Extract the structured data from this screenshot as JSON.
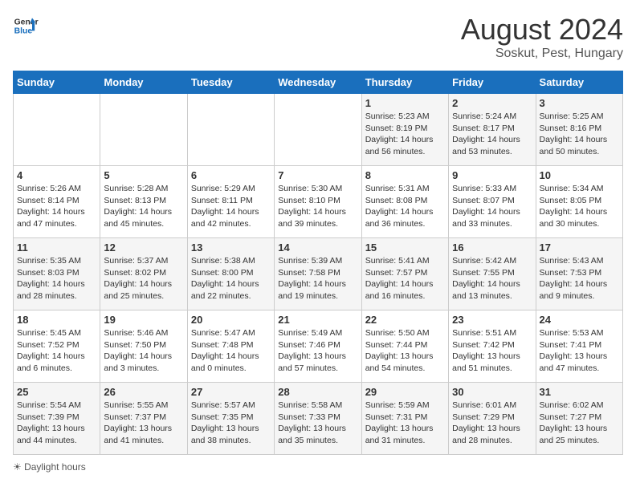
{
  "header": {
    "logo_general": "General",
    "logo_blue": "Blue",
    "month_year": "August 2024",
    "location": "Soskut, Pest, Hungary"
  },
  "weekdays": [
    "Sunday",
    "Monday",
    "Tuesday",
    "Wednesday",
    "Thursday",
    "Friday",
    "Saturday"
  ],
  "legend": {
    "label": "Daylight hours"
  },
  "weeks": [
    [
      {
        "day": "",
        "info": ""
      },
      {
        "day": "",
        "info": ""
      },
      {
        "day": "",
        "info": ""
      },
      {
        "day": "",
        "info": ""
      },
      {
        "day": "1",
        "info": "Sunrise: 5:23 AM\nSunset: 8:19 PM\nDaylight: 14 hours and 56 minutes."
      },
      {
        "day": "2",
        "info": "Sunrise: 5:24 AM\nSunset: 8:17 PM\nDaylight: 14 hours and 53 minutes."
      },
      {
        "day": "3",
        "info": "Sunrise: 5:25 AM\nSunset: 8:16 PM\nDaylight: 14 hours and 50 minutes."
      }
    ],
    [
      {
        "day": "4",
        "info": "Sunrise: 5:26 AM\nSunset: 8:14 PM\nDaylight: 14 hours and 47 minutes."
      },
      {
        "day": "5",
        "info": "Sunrise: 5:28 AM\nSunset: 8:13 PM\nDaylight: 14 hours and 45 minutes."
      },
      {
        "day": "6",
        "info": "Sunrise: 5:29 AM\nSunset: 8:11 PM\nDaylight: 14 hours and 42 minutes."
      },
      {
        "day": "7",
        "info": "Sunrise: 5:30 AM\nSunset: 8:10 PM\nDaylight: 14 hours and 39 minutes."
      },
      {
        "day": "8",
        "info": "Sunrise: 5:31 AM\nSunset: 8:08 PM\nDaylight: 14 hours and 36 minutes."
      },
      {
        "day": "9",
        "info": "Sunrise: 5:33 AM\nSunset: 8:07 PM\nDaylight: 14 hours and 33 minutes."
      },
      {
        "day": "10",
        "info": "Sunrise: 5:34 AM\nSunset: 8:05 PM\nDaylight: 14 hours and 30 minutes."
      }
    ],
    [
      {
        "day": "11",
        "info": "Sunrise: 5:35 AM\nSunset: 8:03 PM\nDaylight: 14 hours and 28 minutes."
      },
      {
        "day": "12",
        "info": "Sunrise: 5:37 AM\nSunset: 8:02 PM\nDaylight: 14 hours and 25 minutes."
      },
      {
        "day": "13",
        "info": "Sunrise: 5:38 AM\nSunset: 8:00 PM\nDaylight: 14 hours and 22 minutes."
      },
      {
        "day": "14",
        "info": "Sunrise: 5:39 AM\nSunset: 7:58 PM\nDaylight: 14 hours and 19 minutes."
      },
      {
        "day": "15",
        "info": "Sunrise: 5:41 AM\nSunset: 7:57 PM\nDaylight: 14 hours and 16 minutes."
      },
      {
        "day": "16",
        "info": "Sunrise: 5:42 AM\nSunset: 7:55 PM\nDaylight: 14 hours and 13 minutes."
      },
      {
        "day": "17",
        "info": "Sunrise: 5:43 AM\nSunset: 7:53 PM\nDaylight: 14 hours and 9 minutes."
      }
    ],
    [
      {
        "day": "18",
        "info": "Sunrise: 5:45 AM\nSunset: 7:52 PM\nDaylight: 14 hours and 6 minutes."
      },
      {
        "day": "19",
        "info": "Sunrise: 5:46 AM\nSunset: 7:50 PM\nDaylight: 14 hours and 3 minutes."
      },
      {
        "day": "20",
        "info": "Sunrise: 5:47 AM\nSunset: 7:48 PM\nDaylight: 14 hours and 0 minutes."
      },
      {
        "day": "21",
        "info": "Sunrise: 5:49 AM\nSunset: 7:46 PM\nDaylight: 13 hours and 57 minutes."
      },
      {
        "day": "22",
        "info": "Sunrise: 5:50 AM\nSunset: 7:44 PM\nDaylight: 13 hours and 54 minutes."
      },
      {
        "day": "23",
        "info": "Sunrise: 5:51 AM\nSunset: 7:42 PM\nDaylight: 13 hours and 51 minutes."
      },
      {
        "day": "24",
        "info": "Sunrise: 5:53 AM\nSunset: 7:41 PM\nDaylight: 13 hours and 47 minutes."
      }
    ],
    [
      {
        "day": "25",
        "info": "Sunrise: 5:54 AM\nSunset: 7:39 PM\nDaylight: 13 hours and 44 minutes."
      },
      {
        "day": "26",
        "info": "Sunrise: 5:55 AM\nSunset: 7:37 PM\nDaylight: 13 hours and 41 minutes."
      },
      {
        "day": "27",
        "info": "Sunrise: 5:57 AM\nSunset: 7:35 PM\nDaylight: 13 hours and 38 minutes."
      },
      {
        "day": "28",
        "info": "Sunrise: 5:58 AM\nSunset: 7:33 PM\nDaylight: 13 hours and 35 minutes."
      },
      {
        "day": "29",
        "info": "Sunrise: 5:59 AM\nSunset: 7:31 PM\nDaylight: 13 hours and 31 minutes."
      },
      {
        "day": "30",
        "info": "Sunrise: 6:01 AM\nSunset: 7:29 PM\nDaylight: 13 hours and 28 minutes."
      },
      {
        "day": "31",
        "info": "Sunrise: 6:02 AM\nSunset: 7:27 PM\nDaylight: 13 hours and 25 minutes."
      }
    ]
  ]
}
